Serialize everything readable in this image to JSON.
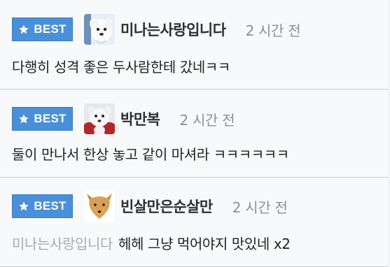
{
  "comments": [
    {
      "badge": "BEST",
      "avatar_icon": "white-dog-avatar",
      "nickname": "미나는사랑입니다",
      "time": "2 시간 전",
      "mention": "",
      "text": "다행히 성격 좋은 두사람한테 갔네ㅋㅋ"
    },
    {
      "badge": "BEST",
      "avatar_icon": "white-dog-red-avatar",
      "nickname": "박만복",
      "time": "2 시간 전",
      "mention": "",
      "text": "둘이 만나서 한상 놓고 같이 마셔라 ㅋㅋㅋㅋㅋㅋ"
    },
    {
      "badge": "BEST",
      "avatar_icon": "shiba-dog-avatar",
      "nickname": "빈살만은순살만",
      "time": "2 시간 전",
      "mention": "미나는사랑입니다",
      "text": "헤헤 그냥 먹어야지 맛있네 x2"
    }
  ],
  "colors": {
    "badge_bg": "#4a90d9",
    "mention": "#a7abb1",
    "time": "#8b8f95"
  }
}
